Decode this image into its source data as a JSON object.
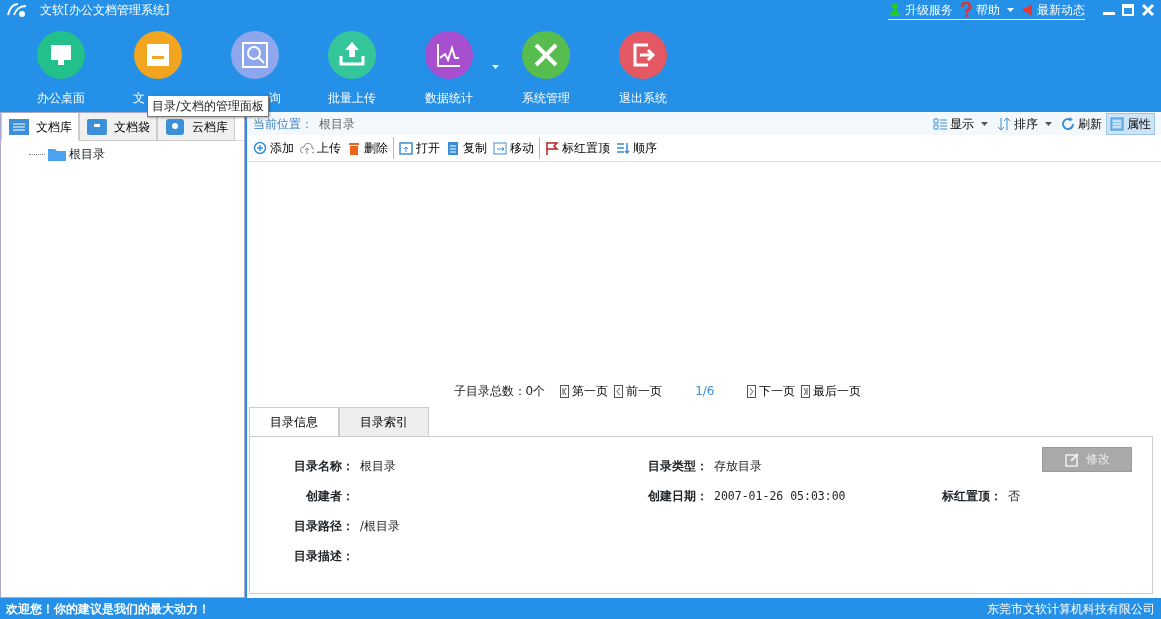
{
  "window": {
    "title": "文软[办公文档管理系统]"
  },
  "title_links": [
    {
      "label": "升级服务",
      "kind": "upgrade",
      "dropdown": false
    },
    {
      "label": "帮助",
      "kind": "help",
      "dropdown": true
    },
    {
      "label": "最新动态",
      "kind": "news",
      "dropdown": false
    }
  ],
  "toolbar": [
    {
      "label": "办公桌面",
      "kind": "desktop",
      "color": "#22c08a",
      "dropdown": false
    },
    {
      "label": "文",
      "kind": "cabinet",
      "color": "#f3a51f",
      "dropdown": false,
      "tooltip": "目录/文档的管理面板"
    },
    {
      "label": "询",
      "kind": "search",
      "color": "#8ea6ee",
      "dropdown": false
    },
    {
      "label": "批量上传",
      "kind": "upload",
      "color": "#34c69a",
      "dropdown": false
    },
    {
      "label": "数据统计",
      "kind": "chart",
      "color": "#a84fd0",
      "dropdown": true
    },
    {
      "label": "系统管理",
      "kind": "tools",
      "color": "#56bd4e",
      "dropdown": false
    },
    {
      "label": "退出系统",
      "kind": "exit",
      "color": "#e45864",
      "dropdown": false
    }
  ],
  "left_tabs": [
    {
      "label": "文档库",
      "kind": "library",
      "selected": true
    },
    {
      "label": "文档袋",
      "kind": "bag",
      "selected": false
    },
    {
      "label": "云档库",
      "kind": "cloud",
      "selected": false
    }
  ],
  "tree": [
    {
      "label": "根目录"
    }
  ],
  "location": {
    "label": "当前位置：",
    "value": "根目录"
  },
  "view_tools": [
    {
      "label": "显示",
      "kind": "view",
      "dropdown": true,
      "selected": false
    },
    {
      "label": "排序",
      "kind": "sort",
      "dropdown": true,
      "selected": false
    },
    {
      "label": "刷新",
      "kind": "refresh",
      "dropdown": false,
      "selected": false
    },
    {
      "label": "属性",
      "kind": "properties",
      "dropdown": false,
      "selected": true
    }
  ],
  "actions": [
    {
      "label": "添加",
      "kind": "add",
      "separator_before": false
    },
    {
      "label": "上传",
      "kind": "upload",
      "separator_before": false
    },
    {
      "label": "删除",
      "kind": "delete",
      "separator_before": false
    },
    {
      "label": "打开",
      "kind": "open",
      "separator_before": true
    },
    {
      "label": "复制",
      "kind": "copy",
      "separator_before": false
    },
    {
      "label": "移动",
      "kind": "move",
      "separator_before": false
    },
    {
      "label": "标红置顶",
      "kind": "flag",
      "separator_before": true
    },
    {
      "label": "顺序",
      "kind": "order",
      "separator_before": false
    }
  ],
  "pagination": {
    "summary": "子目录总数：0个",
    "first": "第一页",
    "prev": "前一页",
    "page": "1/6",
    "next": "下一页",
    "last": "最后一页"
  },
  "detail_tabs": [
    {
      "label": "目录信息",
      "selected": true
    },
    {
      "label": "目录索引",
      "selected": false
    }
  ],
  "edit_button": {
    "label": "修改",
    "disabled": true
  },
  "fields": [
    [
      {
        "label": "目录名称：",
        "value": "根目录"
      },
      {
        "label": "目录类型：",
        "value": "存放目录"
      }
    ],
    [
      {
        "label": "创建者："
      },
      {
        "label": "创建日期：",
        "value": "2007-01-26 05:03:00"
      },
      {
        "label": "标红置顶：",
        "value": "否"
      }
    ],
    [
      {
        "label": "目录路径：",
        "value": "/根目录"
      }
    ],
    [
      {
        "label": "目录描述："
      }
    ]
  ],
  "status_bar": {
    "left": "欢迎您！你的建议是我们的最大动力！",
    "right": "东莞市文软计算机科技有限公司"
  }
}
